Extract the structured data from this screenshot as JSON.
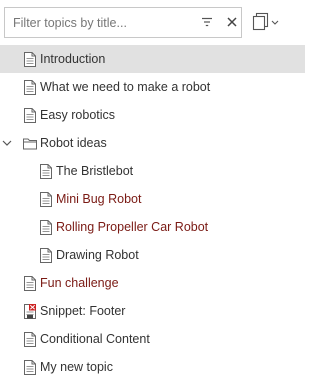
{
  "filter": {
    "placeholder": "Filter topics by title..."
  },
  "icons": {
    "filter": "filter-icon",
    "clear": "close-icon",
    "view": "copy-view-icon",
    "document": "document-icon",
    "folder": "folder-icon",
    "snippet": "snippet-icon",
    "expand": "chevron-down-icon"
  },
  "colors": {
    "accent_text": "#7a1a14",
    "selected_bg": "#e1e1e1",
    "snippet_badge": "#cc2222"
  },
  "tree": [
    {
      "label": "Introduction",
      "level": 0,
      "type": "document",
      "selected": true,
      "accent": false
    },
    {
      "label": "What we need to make a robot",
      "level": 0,
      "type": "document",
      "selected": false,
      "accent": false
    },
    {
      "label": "Easy robotics",
      "level": 0,
      "type": "document",
      "selected": false,
      "accent": false
    },
    {
      "label": "Robot ideas",
      "level": 0,
      "type": "folder",
      "expanded": true,
      "selected": false,
      "accent": false
    },
    {
      "label": "The Bristlebot",
      "level": 1,
      "type": "document",
      "selected": false,
      "accent": false
    },
    {
      "label": "Mini Bug Robot",
      "level": 1,
      "type": "document",
      "selected": false,
      "accent": true
    },
    {
      "label": "Rolling Propeller Car Robot",
      "level": 1,
      "type": "document",
      "selected": false,
      "accent": true
    },
    {
      "label": "Drawing Robot",
      "level": 1,
      "type": "document",
      "selected": false,
      "accent": false
    },
    {
      "label": "Fun challenge",
      "level": 0,
      "type": "document",
      "selected": false,
      "accent": true
    },
    {
      "label": "Snippet: Footer",
      "level": 0,
      "type": "snippet",
      "selected": false,
      "accent": false
    },
    {
      "label": "Conditional Content",
      "level": 0,
      "type": "document",
      "selected": false,
      "accent": false
    },
    {
      "label": "My new topic",
      "level": 0,
      "type": "document",
      "selected": false,
      "accent": false
    }
  ]
}
